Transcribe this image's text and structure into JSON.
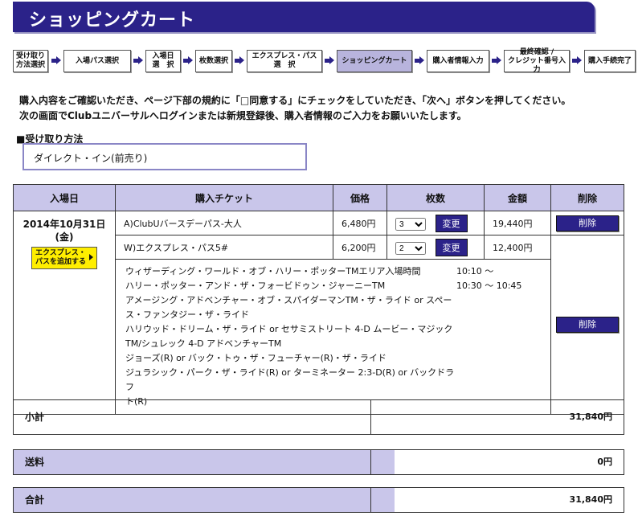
{
  "header": {
    "title": "ショッピングカート"
  },
  "steps": [
    "受け取り\n方法選択",
    "入場パス選択",
    "入場日\n選　択",
    "枚数選択",
    "エクスプレス・パス\n選　択",
    "ショッピングカート",
    "購入者情報入力",
    "最終確認 /\nクレジット番号入力",
    "購入手続完了"
  ],
  "message": {
    "line1": "購入内容をご確認いただき、ページ下部の規約に「□同意する」にチェックをしていただき、「次へ」ボタンを押してください。",
    "line2": "次の画面でClubユニバーサルへログインまたは新規登録後、購入者情報のご入力をお願いいたします。"
  },
  "receive": {
    "label": "■受け取り方法",
    "value": "ダイレクト・イン(前売り)"
  },
  "table": {
    "headers": [
      "入場日",
      "購入チケット",
      "価格",
      "枚数",
      "金額",
      "削除"
    ],
    "date": "2014年10月31日\n(金)",
    "express_button": "エクスプレス・\nパスを追加する",
    "change_label": "変更",
    "delete_label": "削除",
    "rows": [
      {
        "ticket": "A)ClubUバースデーパス-大人",
        "price": "6,480円",
        "qty": "3",
        "amount": "19,440円"
      },
      {
        "ticket": "W)エクスプレス・パス5#",
        "price": "6,200円",
        "qty": "2",
        "amount": "12,400円"
      }
    ],
    "attractions": [
      {
        "name": "ウィザーディング・ワールド・オブ・ハリー・ポッターTMエリア入場時間",
        "time": "10:10 〜"
      },
      {
        "name": "ハリー・ポッター・アンド・ザ・フォービドゥン・ジャーニーTM",
        "time": "10:30 〜 10:45"
      },
      {
        "name": "アメージング・アドベンチャー・オブ・スパイダーマンTM・ザ・ライド or スペー",
        "time": ""
      },
      {
        "name": "ス・ファンタジー・ザ・ライド",
        "time": ""
      },
      {
        "name": "ハリウッド・ドリーム・ザ・ライド or セサミストリート 4-D ムービー・マジック",
        "time": ""
      },
      {
        "name": "TM/シュレック 4-D アドベンチャーTM",
        "time": ""
      },
      {
        "name": "ジョーズ(R) or バック・トゥ・ザ・フューチャー(R)・ザ・ライド",
        "time": ""
      },
      {
        "name": "ジュラシック・パーク・ザ・ライド(R) or ターミネーター 2:3-D(R) or バックドラフ",
        "time": ""
      },
      {
        "name": "ト(R)",
        "time": ""
      }
    ]
  },
  "summary": {
    "subtotal_label": "小計",
    "subtotal_value": "31,840円",
    "shipping_label": "送料",
    "shipping_value": "0円",
    "total_label": "合計",
    "total_value": "31,840円"
  }
}
